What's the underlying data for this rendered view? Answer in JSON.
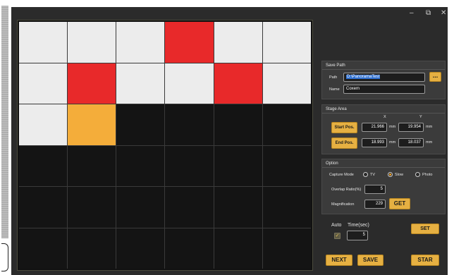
{
  "window": {
    "minimize": "–",
    "restore": "⧉",
    "close": "✕"
  },
  "grid": {
    "rows": [
      [
        "white",
        "white",
        "white",
        "red",
        "white",
        "white"
      ],
      [
        "white",
        "red",
        "white",
        "white",
        "red",
        "white"
      ],
      [
        "white",
        "orange",
        "black",
        "black",
        "black",
        "black"
      ],
      [
        "black",
        "black",
        "black",
        "black",
        "black",
        "black"
      ],
      [
        "black",
        "black",
        "black",
        "black",
        "black",
        "black"
      ],
      [
        "black",
        "black",
        "black",
        "black",
        "black",
        "black"
      ]
    ]
  },
  "save_path": {
    "title": "Save Path",
    "path_label": "Path",
    "path_value": "D:\\PanoramaTest",
    "browse_label": "...",
    "name_label": "Name",
    "name_value": "Coxem"
  },
  "stage_area": {
    "title": "Stage Area",
    "x_label": "X",
    "y_label": "Y",
    "unit": "mm",
    "start_label": "Start Pos.",
    "start_x": "21.966",
    "start_y": "19.954",
    "end_label": "End Pos.",
    "end_x": "18.993",
    "end_y": "18.037"
  },
  "option": {
    "title": "Option",
    "capture_mode_label": "Capture Mode",
    "modes": [
      "TV",
      "Slow",
      "Photo"
    ],
    "selected_mode": "Slow",
    "overlap_label": "Overlap Ratio(%)",
    "overlap_value": "5",
    "magnification_label": "Magnification",
    "magnification_value": "229",
    "get_label": "GET"
  },
  "auto": {
    "auto_label": "Auto",
    "checked": true,
    "time_label": "Time(sec)",
    "time_value": "5",
    "set_label": "SET"
  },
  "buttons": {
    "next": "NEXT",
    "save": "SAVE",
    "start": "STAR"
  },
  "colors": {
    "red": "#e8292a",
    "orange": "#f4ad3a",
    "white": "#ececec",
    "black": "#141414",
    "gold": "#e6b042"
  }
}
